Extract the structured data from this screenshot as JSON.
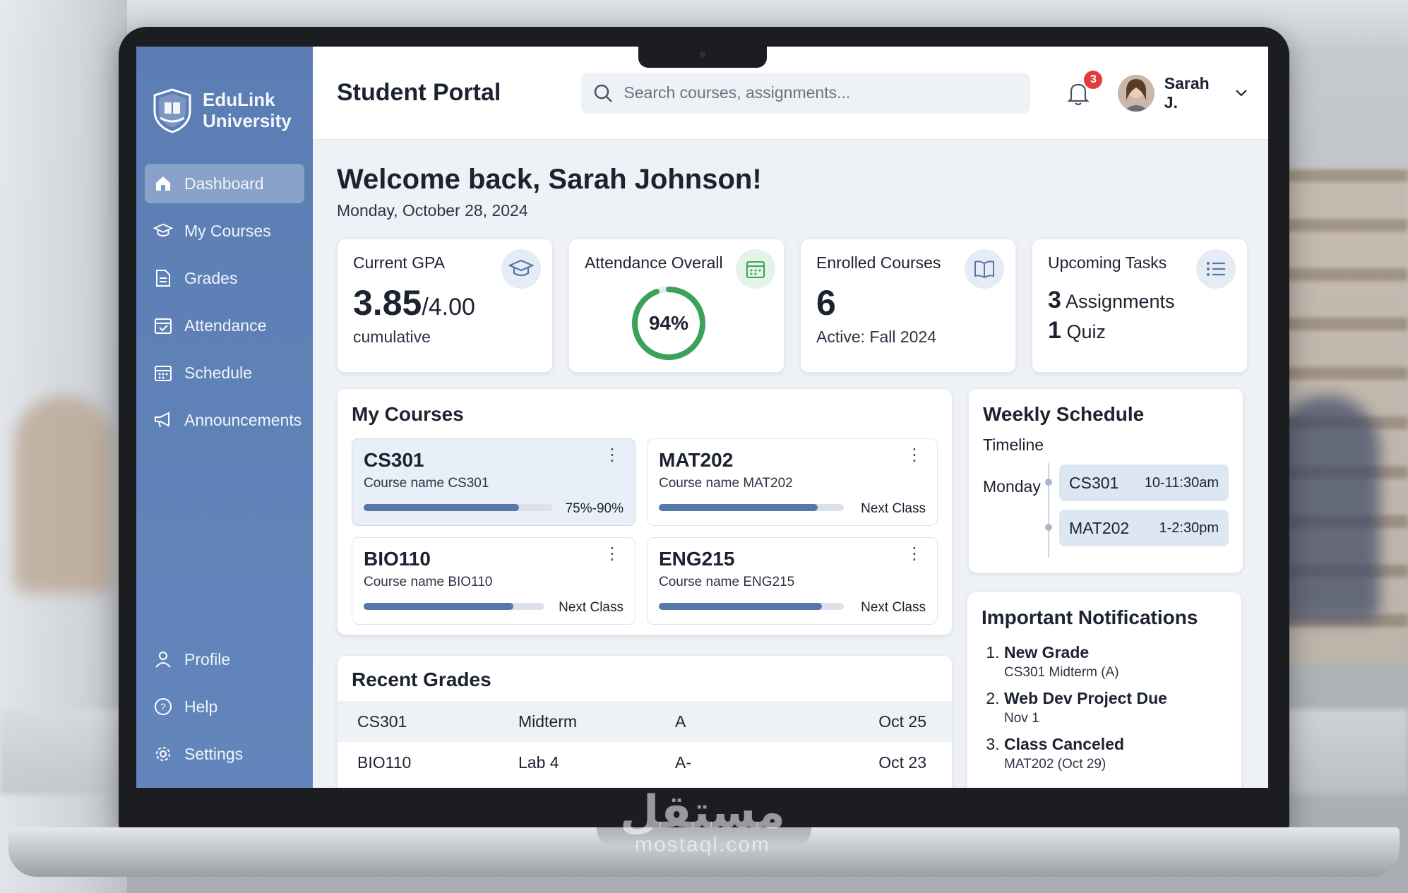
{
  "brand": {
    "line1": "EduLink",
    "line2": "University"
  },
  "sidebar": {
    "items": [
      {
        "label": "Dashboard",
        "icon": "home-icon",
        "active": true
      },
      {
        "label": "My Courses",
        "icon": "graduation-cap-icon"
      },
      {
        "label": "Grades",
        "icon": "document-icon"
      },
      {
        "label": "Attendance",
        "icon": "calendar-check-icon"
      },
      {
        "label": "Schedule",
        "icon": "calendar-icon"
      },
      {
        "label": "Announcements",
        "icon": "megaphone-icon"
      }
    ],
    "bottom": [
      {
        "label": "Profile",
        "icon": "user-icon"
      },
      {
        "label": "Help",
        "icon": "help-icon"
      },
      {
        "label": "Settings",
        "icon": "gear-icon"
      }
    ]
  },
  "header": {
    "title": "Student Portal",
    "search_placeholder": "Search courses, assignments...",
    "notifications_count": "3",
    "user_name": "Sarah J."
  },
  "welcome": {
    "heading": "Welcome back, Sarah Johnson!",
    "date": "Monday, October 28, 2024"
  },
  "stats": {
    "gpa": {
      "label": "Current GPA",
      "value": "3.85",
      "scale": "/4.00",
      "sub": "cumulative"
    },
    "attendance": {
      "label": "Attendance Overall",
      "value": "94%",
      "percent": 94
    },
    "enrolled": {
      "label": "Enrolled Courses",
      "value": "6",
      "sub": "Active: Fall 2024"
    },
    "tasks": {
      "label": "Upcoming Tasks",
      "count1": "3",
      "item1": "Assignments",
      "count2": "1",
      "item2": "Quiz"
    }
  },
  "courses": {
    "title": "My Courses",
    "items": [
      {
        "code": "CS301",
        "name": "Course name CS301",
        "status": "75%-90%",
        "progress": 0.82
      },
      {
        "code": "MAT202",
        "name": "Course name MAT202",
        "status": "Next Class",
        "progress": 0.86
      },
      {
        "code": "BIO110",
        "name": "Course name BIO110",
        "status": "Next Class",
        "progress": 0.83
      },
      {
        "code": "ENG215",
        "name": "Course name ENG215",
        "status": "Next Class",
        "progress": 0.88
      }
    ]
  },
  "schedule": {
    "title": "Weekly Schedule",
    "subtitle": "Timeline",
    "day": "Monday",
    "slots": [
      {
        "course": "CS301",
        "time": "10-11:30am"
      },
      {
        "course": "MAT202",
        "time": "1-2:30pm"
      }
    ]
  },
  "grades": {
    "title": "Recent Grades",
    "rows": [
      {
        "course": "CS301",
        "item": "Midterm",
        "grade": "A",
        "date": "Oct 25"
      },
      {
        "course": "BIO110",
        "item": "Lab 4",
        "grade": "A-",
        "date": "Oct 23"
      }
    ]
  },
  "notifications": {
    "title": "Important Notifications",
    "items": [
      {
        "title": "New Grade",
        "detail": "CS301 Midterm (A)"
      },
      {
        "title": "Web Dev Project Due",
        "detail": "Nov 1"
      },
      {
        "title": "Class Canceled",
        "detail": "MAT202 (Oct 29)"
      }
    ]
  },
  "watermark": {
    "arabic": "مستقل",
    "latin": "mostaql.com"
  },
  "colors": {
    "sidebar": "#5b7db3",
    "accent": "#5677a8",
    "attendance_ring": "#3aa35a",
    "badge": "#e23b3b"
  }
}
